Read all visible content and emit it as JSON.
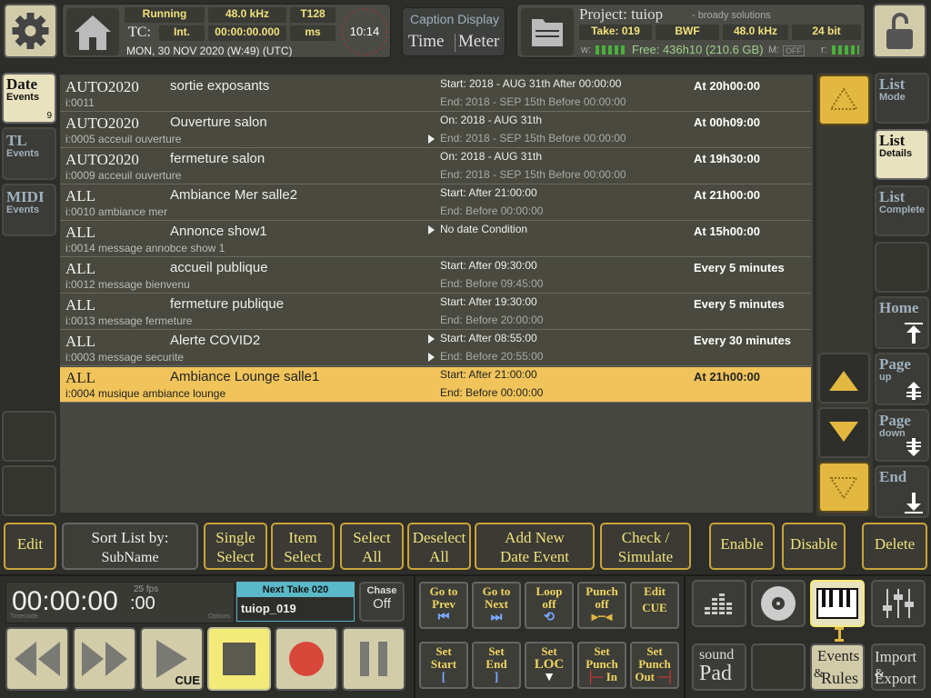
{
  "header": {
    "status": "Running",
    "sample_rate": "48.0 kHz",
    "tc_rate": "T128",
    "tc_label": "TC:",
    "tc_mode": "Int.",
    "tc_value": "00:00:00.000",
    "ms": "ms",
    "date": "MON, 30 NOV 2020 (W:49) (UTC)",
    "clock": "10:14",
    "caption_display": "Caption Display",
    "time_label": "Time",
    "meter_label": "Meter",
    "project_label": "Project: tuiop",
    "company": "- broady solutions",
    "take": "Take: 019",
    "format": "BWF",
    "proj_rate": "48.0 kHz",
    "bits": "24 bit",
    "w_label": "w:",
    "free": "Free: 436h10 (210.6 GB)",
    "m_label": "M:",
    "m_off": "OFF",
    "r_label": "r:"
  },
  "left_tabs": [
    {
      "title": "Date",
      "sub": "Events",
      "count": "9"
    },
    {
      "title": "TL",
      "sub": "Events"
    },
    {
      "title": "MIDI",
      "sub": "Events"
    }
  ],
  "right_tabs": [
    {
      "title": "List",
      "sub": "Mode"
    },
    {
      "title": "List",
      "sub": "Details"
    },
    {
      "title": "List",
      "sub": "Complete"
    },
    {
      "title": "Home",
      "sub": ""
    },
    {
      "title": "Page",
      "sub": "up"
    },
    {
      "title": "Page",
      "sub": "down"
    },
    {
      "title": "End",
      "sub": ""
    }
  ],
  "rows": [
    {
      "group": "AUTO2020",
      "name": "sortie exposants",
      "id": "i:0011",
      "start": "Start: 2018 - AUG 31th After 00:00:00",
      "end": "End: 2018 - SEP 15th Before 00:00:00",
      "time": "At 20h00:00",
      "t1": false,
      "t2": false
    },
    {
      "group": "AUTO2020",
      "name": "Ouverture salon",
      "id": "i:0005 acceuil ouverture",
      "start": "On: 2018 - AUG 31th",
      "end": "End: 2018 - SEP 15th Before 00:00:00",
      "time": "At 00h09:00",
      "t1": false,
      "t2": true
    },
    {
      "group": "AUTO2020",
      "name": "fermeture salon",
      "id": "i:0009 acceuil ouverture",
      "start": "On: 2018 - AUG 31th",
      "end": "End: 2018 - SEP 15th Before 00:00:00",
      "time": "At 19h30:00",
      "t1": false,
      "t2": false
    },
    {
      "group": "ALL",
      "name": "Ambiance Mer salle2",
      "id": "i:0010 ambiance mer",
      "start": "Start: After 21:00:00",
      "end": "End: Before 00:00:00",
      "time": "At 21h00:00",
      "t1": false,
      "t2": false
    },
    {
      "group": "ALL",
      "name": "Annonce show1",
      "id": "i:0014 message annobce show 1",
      "start": "No date Condition",
      "end": "",
      "time": "At 15h00:00",
      "t1": true,
      "t2": false
    },
    {
      "group": "ALL",
      "name": "accueil publique",
      "id": "i:0012 message bienvenu",
      "start": "Start: After 09:30:00",
      "end": "End: Before 09:45:00",
      "time": "Every 5 minutes",
      "t1": false,
      "t2": false
    },
    {
      "group": "ALL",
      "name": "fermeture publique",
      "id": "i:0013 message fermeture",
      "start": "Start: After 19:30:00",
      "end": "End: Before 20:00:00",
      "time": "Every 5 minutes",
      "t1": false,
      "t2": false
    },
    {
      "group": "ALL",
      "name": "Alerte COVID2",
      "id": "i:0003 message securite",
      "start": "Start: After 08:55:00",
      "end": "End: Before 20:55:00",
      "time": "Every 30 minutes",
      "t1": true,
      "t2": true
    },
    {
      "group": "ALL",
      "name": "Ambiance Lounge salle1",
      "id": "i:0004 musique ambiance lounge",
      "start": "Start: After 21:00:00",
      "end": "End: Before 00:00:00",
      "time": "At 21h00:00",
      "t1": false,
      "t2": false,
      "selected": true
    }
  ],
  "toolbar": {
    "edit": "Edit",
    "sort_l1": "Sort List by:",
    "sort_l2": "SubName",
    "single_l1": "Single",
    "single_l2": "Select",
    "item_l1": "Item",
    "item_l2": "Select",
    "selall_l1": "Select",
    "selall_l2": "All",
    "desel_l1": "Deselect",
    "desel_l2": "All",
    "addnew_l1": "Add New",
    "addnew_l2": "Date Event",
    "check_l1": "Check /",
    "check_l2": "Simulate",
    "enable": "Enable",
    "disable": "Disable",
    "delete": "Delete"
  },
  "transport": {
    "timecode": "00:00:00",
    "frames": ":00",
    "fps": "25 fps",
    "tc_small": "Timecode",
    "options": "Options",
    "next_take": "Next Take 020",
    "take_name": "tuiop_019",
    "chase": "Chase",
    "chase_val": "Off",
    "cue": "CUE"
  },
  "nav": {
    "goto_prev": [
      "Go to",
      "Prev"
    ],
    "goto_next": [
      "Go to",
      "Next"
    ],
    "loop_off": [
      "Loop",
      "off"
    ],
    "punch_off": [
      "Punch",
      "off"
    ],
    "edit_cue": [
      "Edit",
      "CUE"
    ],
    "set_start": [
      "Set",
      "Start"
    ],
    "set_end": [
      "Set",
      "End"
    ],
    "set_loc": [
      "Set",
      "LOC"
    ],
    "set_punch_in": [
      "Set",
      "Punch",
      "In"
    ],
    "set_punch_out": [
      "Set",
      "Punch",
      "Out"
    ]
  },
  "right_panel": {
    "sound": "sound",
    "pad": "Pad",
    "events": "Events",
    "rules": "Rules",
    "import": "Import",
    "and": "&",
    "export": "Export"
  }
}
